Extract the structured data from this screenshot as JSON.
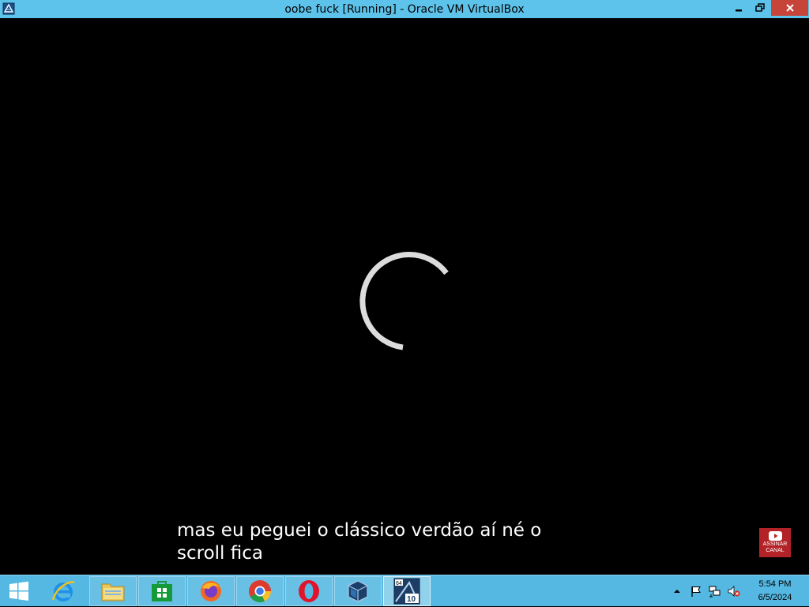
{
  "window": {
    "title": "oobe fuck [Running] - Oracle VM VirtualBox",
    "app_icon": "virtualbox-icon",
    "controls": [
      "minimize-icon",
      "restore-icon",
      "close-icon"
    ]
  },
  "vm_screen": {
    "spinner": "loading-spinner",
    "caption_lines": [
      "mas eu peguei o clássico verdão aí né o",
      "scroll fica"
    ],
    "subscribe_badge": {
      "line1": "ASSINAR",
      "line2": "CANAL"
    }
  },
  "taskbar": {
    "start_icon": "windows-logo-icon",
    "pinned": [
      {
        "name": "internet-explorer-icon"
      },
      {
        "name": "file-explorer-icon"
      },
      {
        "name": "store-icon"
      },
      {
        "name": "firefox-icon"
      },
      {
        "name": "chrome-icon"
      },
      {
        "name": "opera-icon"
      },
      {
        "name": "virtualbox-icon"
      },
      {
        "name": "vm-window-icon",
        "badge_top": "64",
        "badge_num": "10"
      }
    ],
    "tray_icons": [
      "show-hidden-icons",
      "action-center-flag-icon",
      "network-icon",
      "volume-muted-icon"
    ],
    "clock": {
      "time": "5:54 PM",
      "date": "6/5/2024"
    }
  },
  "colors": {
    "titlebar": "#5ec3ea",
    "taskbar": "#55b8e2",
    "close_button": "#c7443a",
    "vm_background": "#000000",
    "spinner": "#dcdcdc",
    "badge": "#b32226"
  }
}
